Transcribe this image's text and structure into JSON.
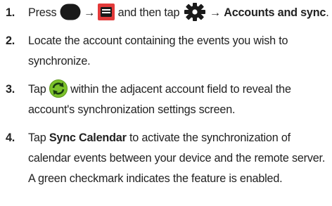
{
  "steps": [
    {
      "num": "1.",
      "press": "Press",
      "arrow": "→",
      "then_tap": "and then tap",
      "target": "Accounts and sync",
      "period": "."
    },
    {
      "num": "2.",
      "text": "Locate the account containing the events you wish to synchronize."
    },
    {
      "num": "3.",
      "tap": "Tap",
      "rest": "within the adjacent account field to reveal the account's synchronization settings screen."
    },
    {
      "num": "4.",
      "tap": "Tap",
      "target": "Sync Calendar",
      "rest": "to activate the synchronization of calendar events between your device and the remote server. A green checkmark indicates the feature is enabled."
    }
  ],
  "icons": {
    "home": "home-key-icon",
    "menu": "menu-key-icon",
    "settings": "settings-gear-icon",
    "sync": "sync-icon"
  },
  "colors": {
    "key_black": "#1a1a1a",
    "menu_red": "#e23a3a",
    "sync_green": "#7cc22b"
  }
}
